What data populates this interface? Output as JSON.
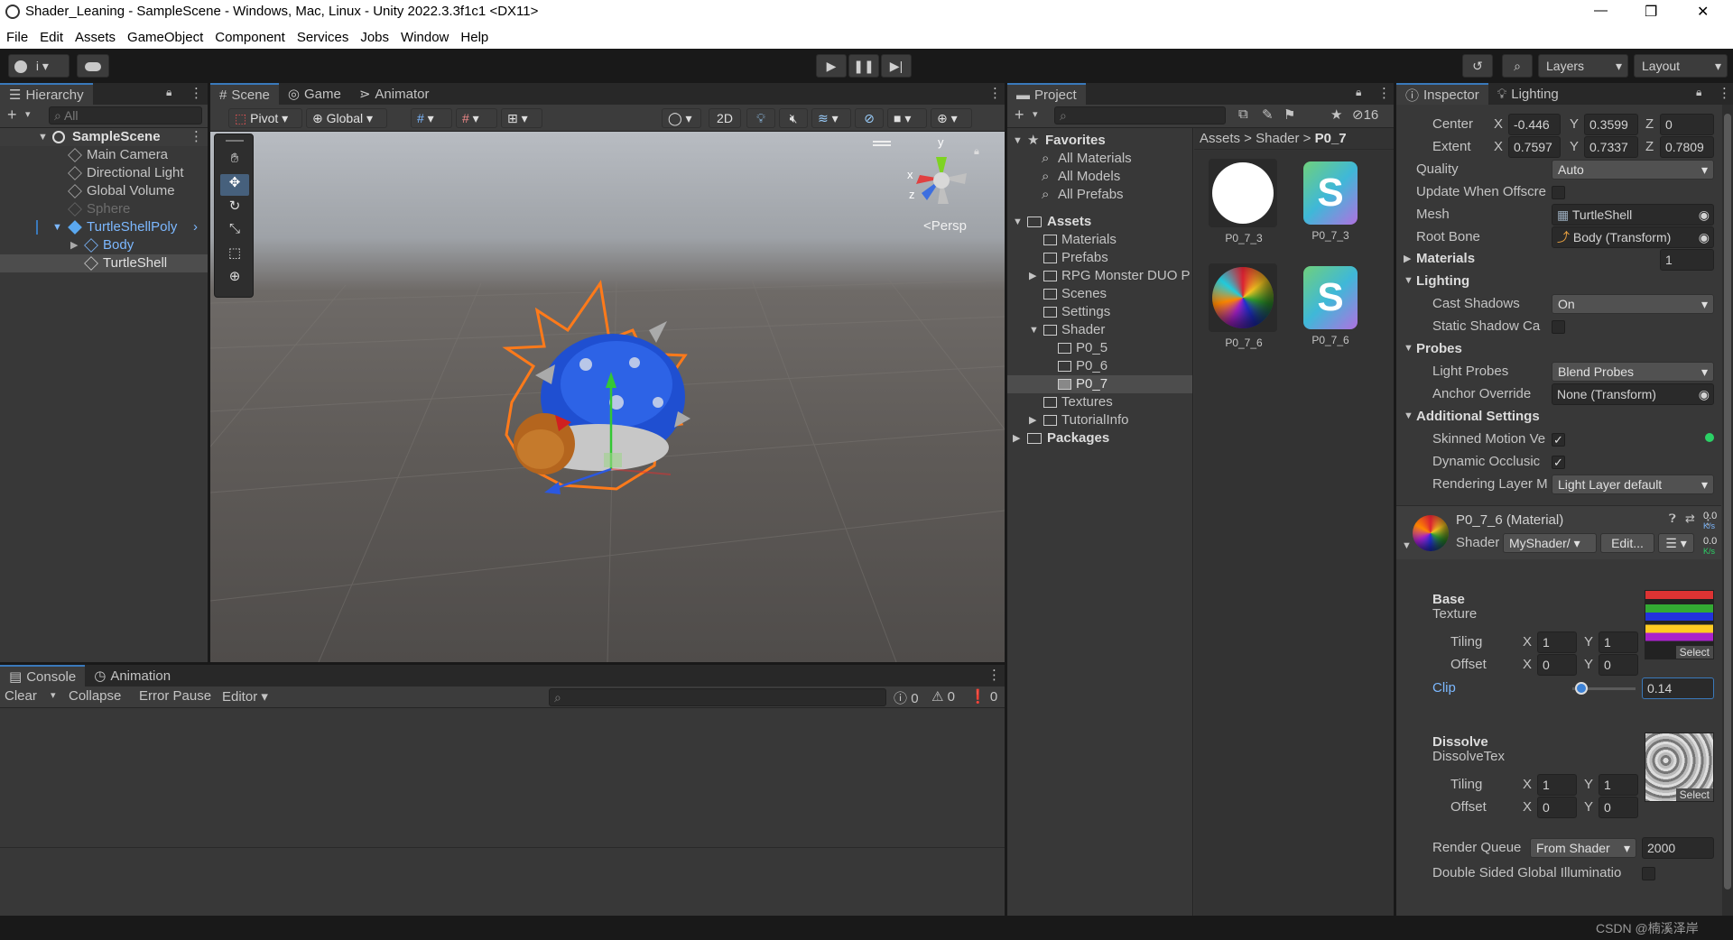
{
  "window": {
    "title": "Shader_Leaning - SampleScene - Windows, Mac, Linux - Unity 2022.3.3f1c1 <DX11>",
    "min": "—",
    "max": "❐",
    "close": "✕"
  },
  "menu": [
    "File",
    "Edit",
    "Assets",
    "GameObject",
    "Component",
    "Services",
    "Jobs",
    "Window",
    "Help"
  ],
  "toolbar": {
    "account": "i",
    "layers": "Layers",
    "layout": "Layout"
  },
  "hierarchy": {
    "tab": "Hierarchy",
    "search_placeholder": "All",
    "add": "+",
    "items": [
      "SampleScene",
      "Main Camera",
      "Directional Light",
      "Global Volume",
      "Sphere",
      "TurtleShellPoly",
      "Body",
      "TurtleShell"
    ]
  },
  "scene": {
    "tabs": [
      "Scene",
      "Game",
      "Animator"
    ],
    "pivot": "Pivot",
    "global": "Global",
    "mode2d": "2D",
    "persp": "<Persp",
    "gizmo_y": "y",
    "gizmo_x": "x",
    "gizmo_z": "z"
  },
  "console": {
    "tabs": [
      "Console",
      "Animation"
    ],
    "clear": "Clear",
    "collapse": "Collapse",
    "error_pause": "Error Pause",
    "editor": "Editor",
    "count_log": "0",
    "count_warn": "0",
    "count_err": "0"
  },
  "project": {
    "tab": "Project",
    "hidden_count": "16",
    "add": "+",
    "breadcrumb": [
      "Assets",
      "Shader",
      "P0_7"
    ],
    "favorites": "Favorites",
    "fav_items": [
      "All Materials",
      "All Models",
      "All Prefabs"
    ],
    "assets": "Assets",
    "asset_folders": [
      "Materials",
      "Prefabs",
      "RPG Monster DUO P",
      "Scenes",
      "Settings",
      "Shader",
      "P0_5",
      "P0_6",
      "P0_7",
      "Textures",
      "TutorialInfo"
    ],
    "packages": "Packages",
    "grid": [
      {
        "name": "P0_7_3",
        "kind": "material"
      },
      {
        "name": "P0_7_3",
        "kind": "shader",
        "glyph": "S"
      },
      {
        "name": "P0_7_6",
        "kind": "material"
      },
      {
        "name": "P0_7_6",
        "kind": "shader",
        "glyph": "S"
      }
    ]
  },
  "inspector": {
    "tabs": [
      "Inspector",
      "Lighting"
    ],
    "center_label": "Center",
    "center": {
      "x": "-0.446",
      "y": "0.3599",
      "z": "0"
    },
    "extent_label": "Extent",
    "extent": {
      "x": "0.7597",
      "y": "0.7337",
      "z": "0.7809"
    },
    "axis": {
      "x": "X",
      "y": "Y",
      "z": "Z"
    },
    "quality_label": "Quality",
    "quality": "Auto",
    "update_label": "Update When Offscre",
    "mesh_label": "Mesh",
    "mesh": "TurtleShell",
    "rootbone_label": "Root Bone",
    "rootbone": "Body (Transform)",
    "materials_label": "Materials",
    "materials_count": "1",
    "lighting_label": "Lighting",
    "cast_label": "Cast Shadows",
    "cast": "On",
    "static_label": "Static Shadow Ca",
    "probes_label": "Probes",
    "lightprobes_label": "Light Probes",
    "lightprobes": "Blend Probes",
    "anchor_label": "Anchor Override",
    "anchor": "None (Transform)",
    "additional_label": "Additional Settings",
    "skinned_label": "Skinned Motion Ve",
    "dynamic_label": "Dynamic Occlusic",
    "rendering_label": "Rendering Layer M",
    "rendering": "Light Layer default",
    "check": "✓",
    "material_title": "P0_7_6 (Material)",
    "shader_label": "Shader",
    "shader": "MyShader/",
    "edit": "Edit...",
    "base_label": "Base",
    "base_tex_label": "Texture",
    "tiling_label": "Tiling",
    "offset_label": "Offset",
    "base_tiling": {
      "x": "1",
      "y": "1"
    },
    "base_offset": {
      "x": "0",
      "y": "0"
    },
    "select": "Select",
    "clip_label": "Clip",
    "clip_value": "0.14",
    "clip_fraction": 0.14,
    "dissolve_label": "Dissolve",
    "dissolve_tex_label": "DissolveTex",
    "dis_tiling": {
      "x": "1",
      "y": "1"
    },
    "dis_offset": {
      "x": "0",
      "y": "0"
    },
    "queue_label": "Render Queue",
    "queue_mode": "From Shader",
    "queue_value": "2000",
    "double_label": "Double Sided Global Illuminatio",
    "stats1": "0.0",
    "stats_unit1": "K/s",
    "stats2": "0.0",
    "stats_unit2": "K/s"
  },
  "watermark": "CSDN @楠溪泽岸",
  "colors": {
    "accent": "#3a79bb",
    "selection": "#2c5d87",
    "selection_text": "#7cb8ff",
    "clip_blue": "#3d82d6"
  }
}
